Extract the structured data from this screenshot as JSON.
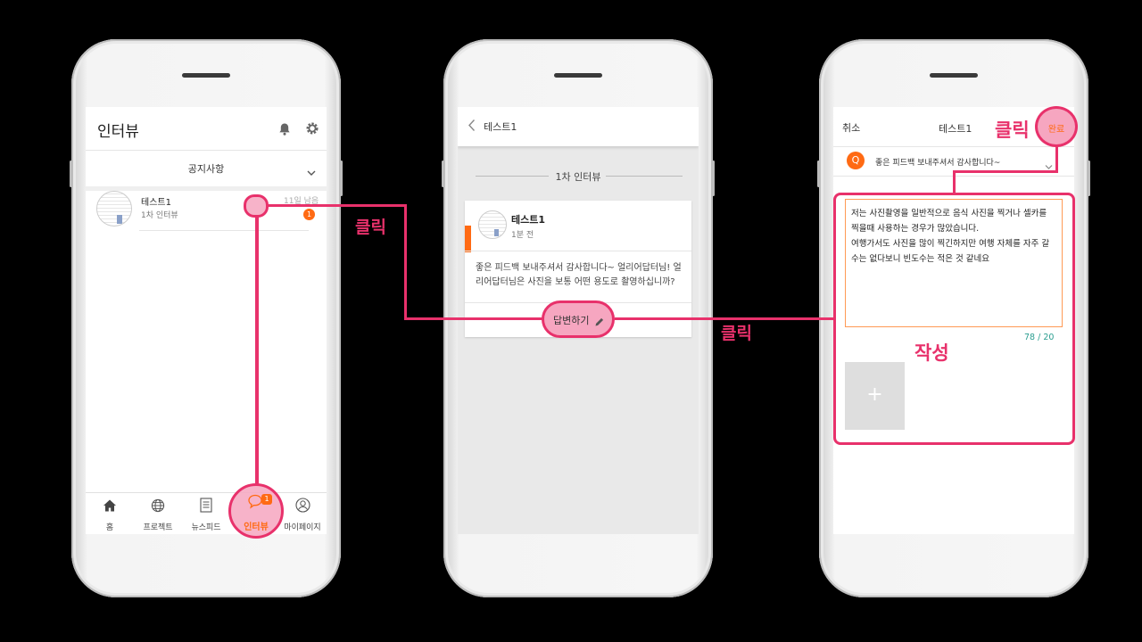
{
  "screen1": {
    "title": "인터뷰",
    "notice_label": "공지사항",
    "item": {
      "name": "테스트1",
      "sub": "1차 인터뷰",
      "days_left": "11일 남음",
      "badge": "1"
    },
    "tabs": [
      {
        "label": "홈",
        "icon": "home-icon"
      },
      {
        "label": "프로젝트",
        "icon": "globe-icon"
      },
      {
        "label": "뉴스피드",
        "icon": "document-icon"
      },
      {
        "label": "인터뷰",
        "icon": "chat-icon",
        "badge": "1"
      },
      {
        "label": "마이페이지",
        "icon": "user-icon"
      }
    ]
  },
  "screen2": {
    "title": "테스트1",
    "section_label": "1차 인터뷰",
    "card": {
      "name": "테스트1",
      "time": "1분 전",
      "body": "좋은 피드백 보내주셔서 감사합니다~ 얼리어답터님! 얼리어답터님은 사진을 보통 어떤 용도로 촬영하십니까?",
      "reply_label": "답변하기"
    }
  },
  "screen3": {
    "cancel": "취소",
    "title": "테스트1",
    "done": "완료",
    "question_badge": "Q",
    "question": "좋은 피드백 보내주셔서 감사합니다~",
    "answer": "저는 사진촬영을 일반적으로 음식 사진을 찍거나 셀카를 찍을때 사용하는 경우가 많았습니다.\n여행가서도 사진을 많이 찍긴하지만 여행 자체를 자주 갈수는 없다보니 빈도수는 적은 것 같네요",
    "counter": "78 / 20",
    "add_photo": "+"
  },
  "annotations": {
    "click": "클릭",
    "write": "작성"
  },
  "colors": {
    "accent": "#ff6a13",
    "annotation": "#e8316b",
    "highlight": "#f6a6c0"
  }
}
